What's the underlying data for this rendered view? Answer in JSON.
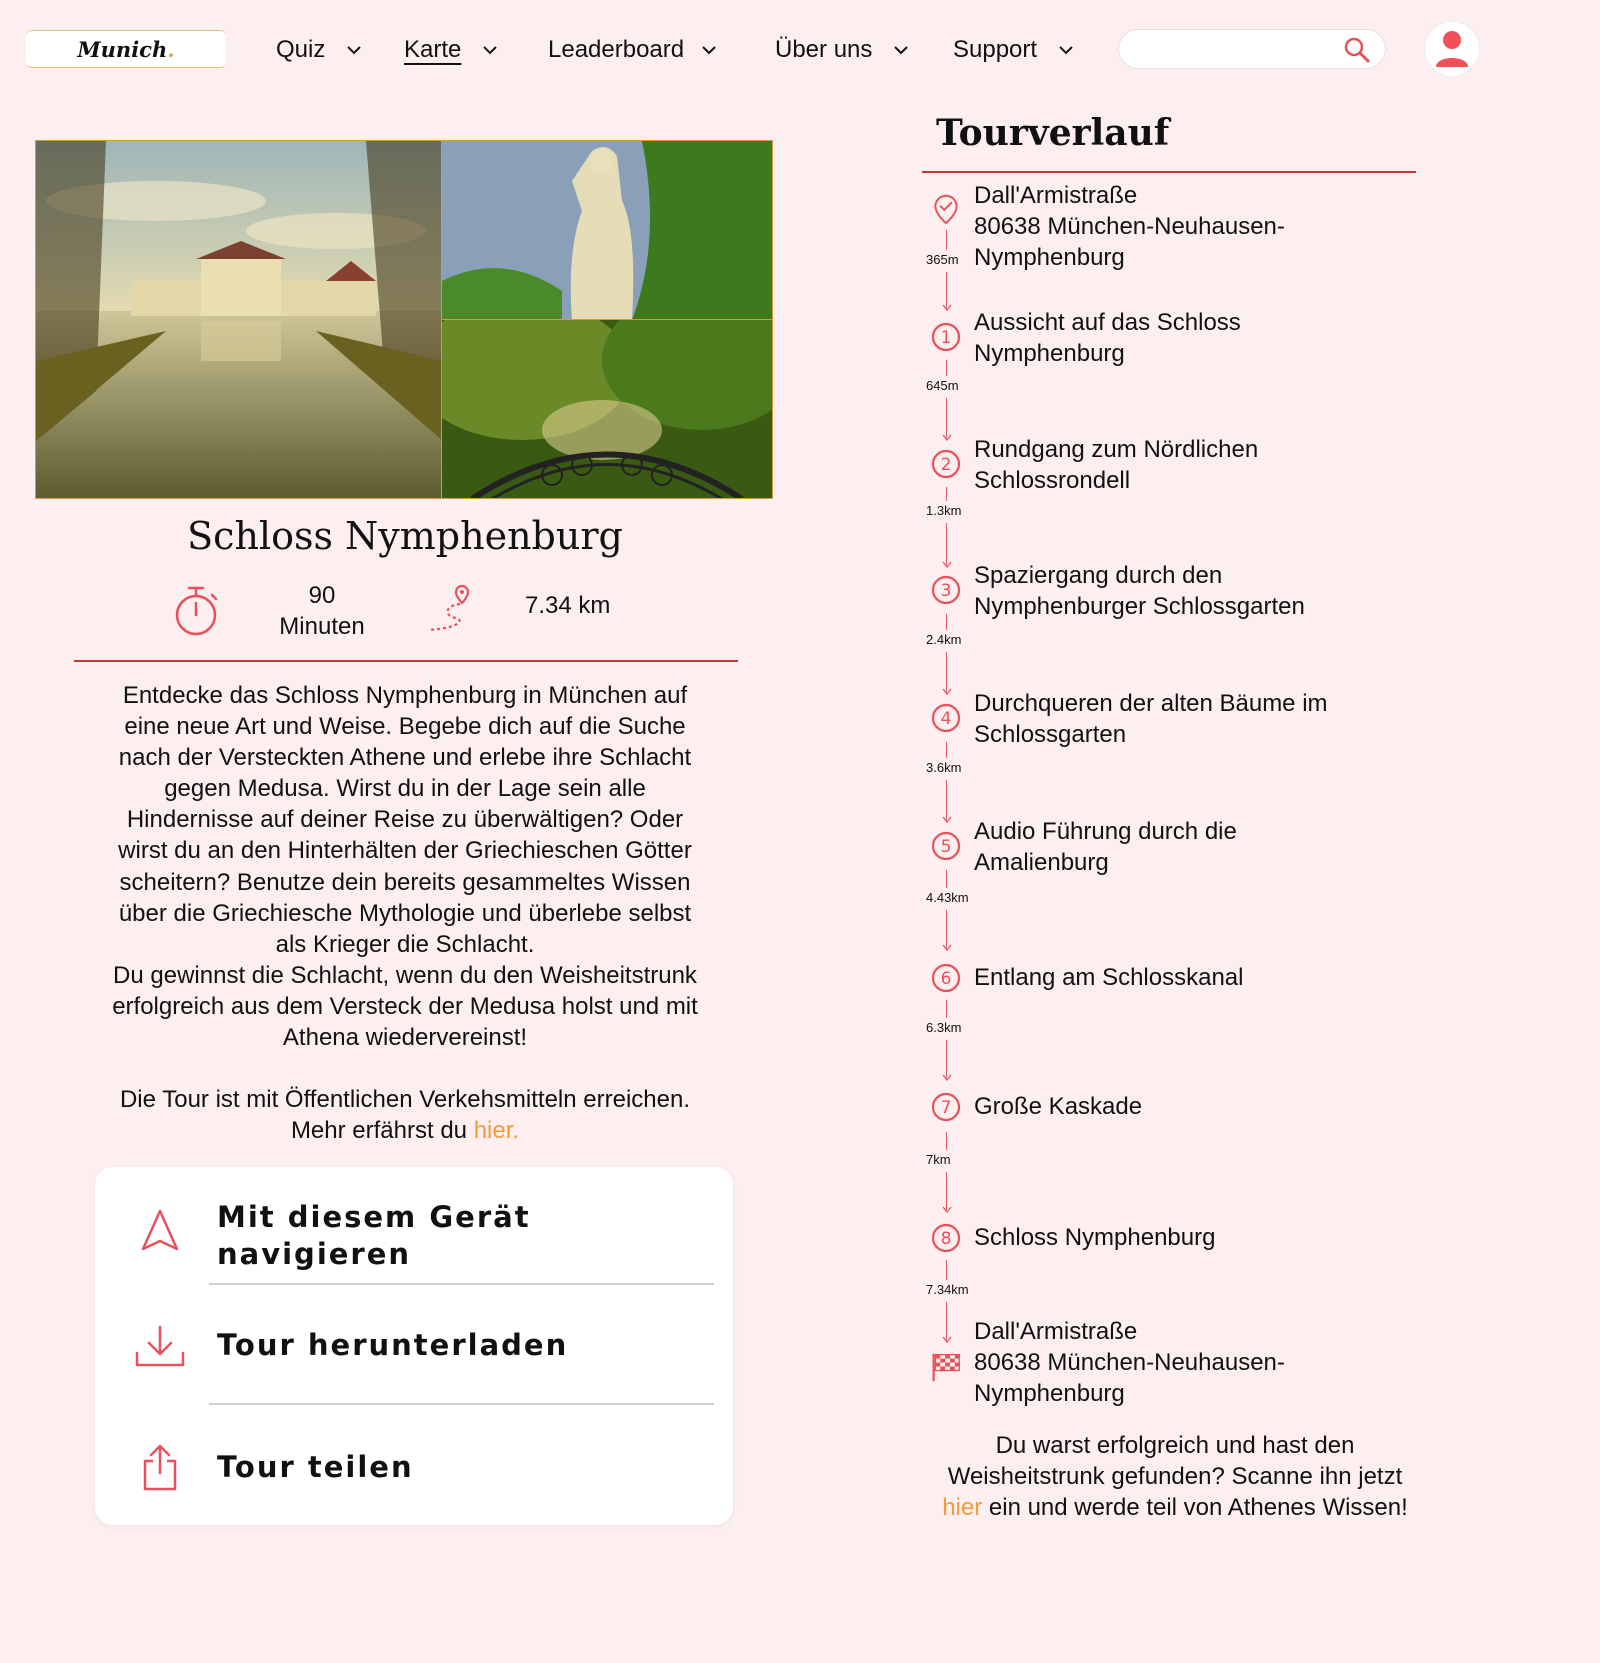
{
  "header": {
    "logo_text": "Munich",
    "logo_dot": ".",
    "nav": [
      {
        "label": "Quiz",
        "active": false
      },
      {
        "label": "Karte",
        "active": true
      },
      {
        "label": "Leaderboard",
        "active": false
      },
      {
        "label": "Über uns",
        "active": false
      },
      {
        "label": "Support",
        "active": false
      }
    ],
    "search_placeholder": ""
  },
  "tour": {
    "title": "Schloss Nymphenburg",
    "duration_value": "90",
    "duration_unit": "Minuten",
    "distance": "7.34 km",
    "description": [
      "Entdecke das Schloss Nymphenburg in München auf",
      "eine neue Art und Weise. Begebe dich auf die Suche",
      "nach der Versteckten Athene und erlebe ihre Schlacht",
      "gegen Medusa. Wirst du in der Lage sein alle",
      "Hindernisse auf deiner Reise zu überwältigen? Oder",
      "wirst du an den Hinterhälten der Griechieschen Götter",
      "scheitern? Benutze dein bereits gesammeltes Wissen",
      "über die Griechiesche Mythologie und überlebe selbst",
      "als Krieger die Schlacht.",
      "Du gewinnst die Schlacht, wenn du den Weisheitstrunk",
      "erfolgreich aus dem Versteck der Medusa holst und mit",
      "Athena wiedervereinst!"
    ],
    "transport_line1": "Die Tour ist mit Öffentlichen Verkehsmitteln erreichen.",
    "transport_line2_prefix": "Mehr erfährst du ",
    "transport_link": "hier."
  },
  "actions": {
    "navigate": "Mit diesem Gerät navigieren",
    "download": "Tour herunterladen",
    "share": "Tour teilen"
  },
  "route": {
    "title": "Tourverlauf",
    "start": [
      "Dall'Armistraße",
      "80638 München-Neuhausen-",
      "Nymphenburg"
    ],
    "stops": [
      {
        "num": "1",
        "lines": [
          "Aussicht auf das Schloss",
          "Nymphenburg"
        ]
      },
      {
        "num": "2",
        "lines": [
          "Rundgang zum Nördlichen",
          "Schlossrondell"
        ]
      },
      {
        "num": "3",
        "lines": [
          "Spaziergang durch den",
          "Nymphenburger Schlossgarten"
        ]
      },
      {
        "num": "4",
        "lines": [
          "Durchqueren der alten Bäume im",
          "Schlossgarten"
        ]
      },
      {
        "num": "5",
        "lines": [
          "Audio Führung durch die",
          "Amalienburg"
        ]
      },
      {
        "num": "6",
        "lines": [
          "Entlang am Schlosskanal"
        ]
      },
      {
        "num": "7",
        "lines": [
          "Große Kaskade"
        ]
      },
      {
        "num": "8",
        "lines": [
          "Schloss Nymphenburg"
        ]
      }
    ],
    "distances": [
      "365m",
      "645m",
      "1.3km",
      "2.4km",
      "3.6km",
      "4.43km",
      "6.3km",
      "7km",
      "7.34km"
    ],
    "end": [
      "Dall'Armistraße",
      "80638 München-Neuhausen-",
      "Nymphenburg"
    ],
    "footer_prefix": "Du warst erfolgreich und hast den Weisheitstrunk gefunden? Scanne ihn jetzt ",
    "footer_link": "hier",
    "footer_suffix": " ein und werde teil von Athenes Wissen!"
  },
  "colors": {
    "background": "#fdefef",
    "accent_red": "#e8505b",
    "divider_red": "#c33a3a",
    "link_orange": "#f29a3c"
  },
  "icons": [
    "chevron-down-icon",
    "search-icon",
    "user-icon",
    "stopwatch-icon",
    "route-icon",
    "check-pin-icon",
    "navigation-arrow-icon",
    "download-icon",
    "share-icon",
    "finish-flag-icon"
  ]
}
